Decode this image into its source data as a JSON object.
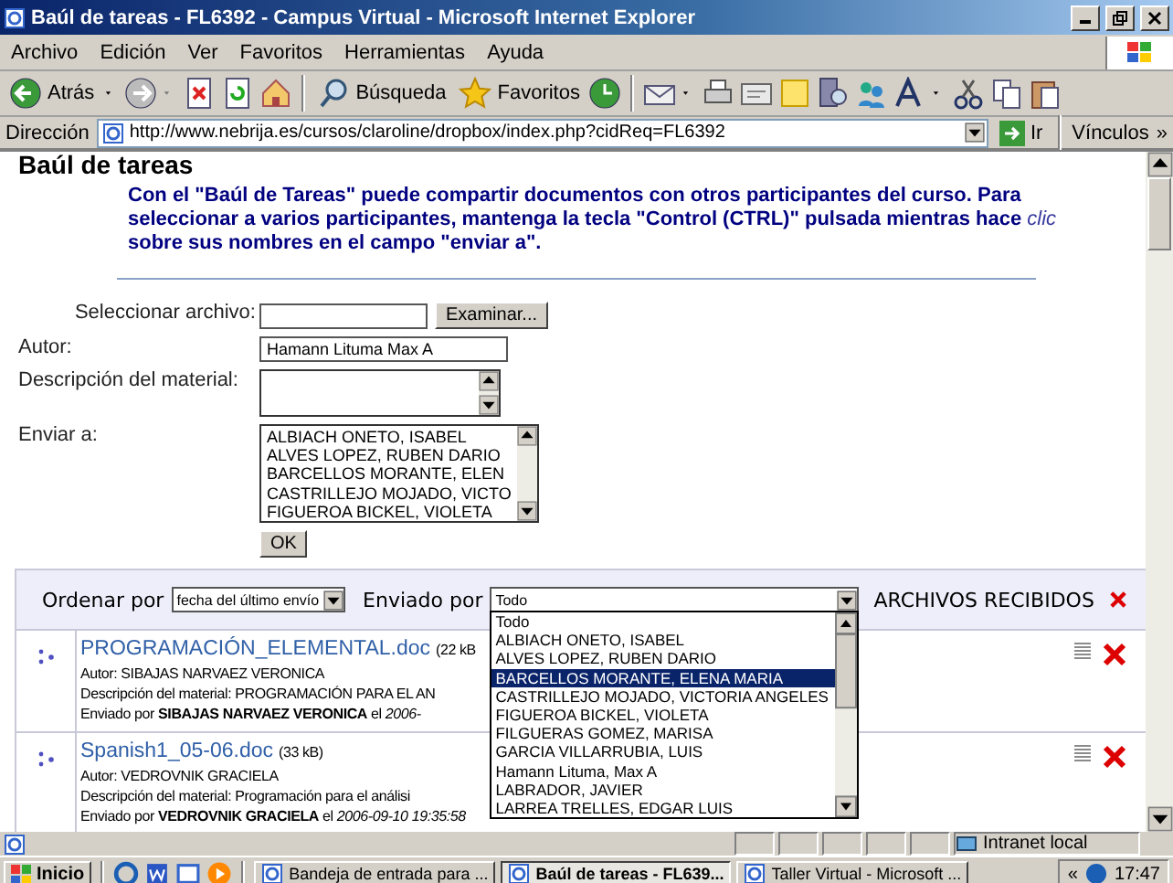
{
  "window": {
    "title": "Baúl de tareas - FL6392 - Campus Virtual - Microsoft Internet Explorer"
  },
  "menu": [
    "Archivo",
    "Edición",
    "Ver",
    "Favoritos",
    "Herramientas",
    "Ayuda"
  ],
  "toolbar": {
    "back": "Atrás",
    "search": "Búsqueda",
    "favorites": "Favoritos"
  },
  "address_bar": {
    "label": "Dirección",
    "url": "http://www.nebrija.es/cursos/claroline/dropbox/index.php?cidReq=FL6392",
    "go": "Ir",
    "links": "Vínculos",
    "more": "»"
  },
  "page": {
    "heading": "Baúl de tareas",
    "intro": "Con el \"Baúl de Tareas\" puede compartir documentos con otros participantes del curso. Para seleccionar a varios participantes, mantenga la tecla \"Control (CTRL)\" pulsada mientras hace *clic* sobre sus nombres en el campo \"enviar a\".",
    "form": {
      "fields": [
        {
          "kind": "file",
          "label": "Seleccionar archivo:",
          "button": "Examinar..."
        },
        {
          "kind": "text",
          "label": "Autor:",
          "value": "Hamann Lituma Max A"
        },
        {
          "kind": "textarea",
          "label": "Descripción del material:"
        },
        {
          "kind": "list",
          "label": "Enviar a:",
          "options": [
            "ALBIACH ONETO, ISABEL",
            "ALVES LOPEZ, RUBEN DARIO",
            "BARCELLOS MORANTE, ELEN",
            "CASTRILLEJO MOJADO, VICTO",
            "FIGUEROA BICKEL, VIOLETA"
          ]
        }
      ],
      "submit": "OK"
    },
    "files": {
      "sort_label": "Ordenar por",
      "sort_value": "fecha del último envío",
      "sender_label": "Enviado por",
      "sender_value": "Todo",
      "title": "ARCHIVOS RECIBIDOS",
      "sender_options": [
        {
          "label": "Todo",
          "selected": false
        },
        {
          "label": "ALBIACH ONETO, ISABEL",
          "selected": false
        },
        {
          "label": "ALVES LOPEZ, RUBEN DARIO",
          "selected": false
        },
        {
          "label": "BARCELLOS MORANTE, ELENA MARIA",
          "selected": true
        },
        {
          "label": "CASTRILLEJO MOJADO, VICTORIA ANGELES",
          "selected": false
        },
        {
          "label": "FIGUEROA BICKEL, VIOLETA",
          "selected": false
        },
        {
          "label": "FILGUERAS GOMEZ, MARISA",
          "selected": false
        },
        {
          "label": "GARCIA VILLARRUBIA, LUIS",
          "selected": false
        },
        {
          "label": "Hamann Lituma, Max A",
          "selected": false
        },
        {
          "label": "LABRADOR, JAVIER",
          "selected": false
        },
        {
          "label": "LARREA TRELLES, EDGAR LUIS",
          "selected": false
        }
      ],
      "rows": [
        {
          "name": "PROGRAMACIÓN_ELEMENTAL.doc",
          "size": "(22 kB",
          "author": "Autor: SIBAJAS NARVAEZ VERONICA",
          "description": "Descripción del material: PROGRAMACIÓN PARA EL AN",
          "sent": "Enviado por **SIBAJAS NARVAEZ VERONICA** el *2006-*"
        },
        {
          "name": "Spanish1_05-06.doc",
          "size": "(33 kB)",
          "author": "Autor: VEDROVNIK GRACIELA",
          "description": "Descripción del material: Programación para el análisi",
          "sent": "Enviado por **VEDROVNIK GRACIELA** el *2006-09-10 19:35:58*"
        }
      ]
    }
  },
  "status_bar": {
    "zone": "Intranet local"
  },
  "taskbar": {
    "start": "Inicio",
    "tasks": [
      {
        "label": "Bandeja de entrada para ...",
        "selected": false
      },
      {
        "label": "Baúl de tareas - FL639...",
        "selected": true
      },
      {
        "label": "Taller Virtual - Microsoft ...",
        "selected": false
      }
    ],
    "tray_toggle": "«",
    "clock": "17:47"
  }
}
